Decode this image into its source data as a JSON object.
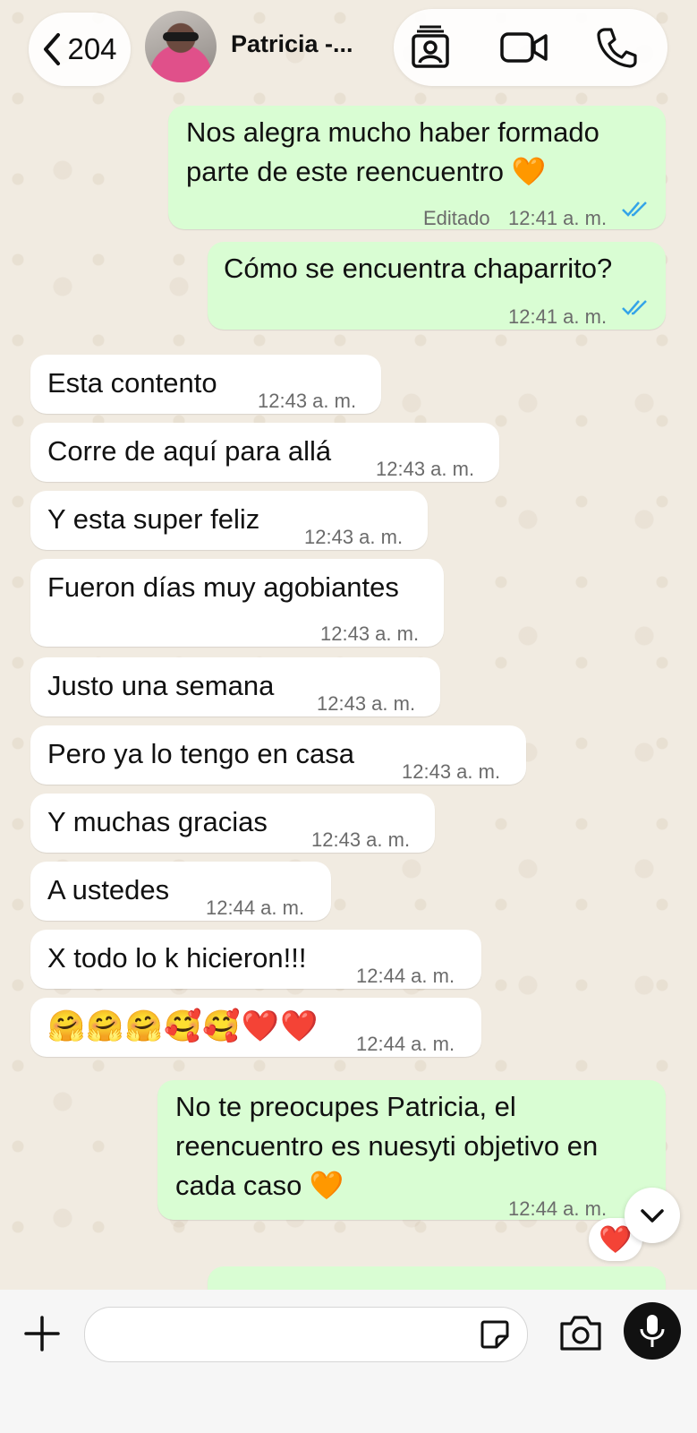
{
  "header": {
    "back_count": "204",
    "contact_name": "Patricia -..."
  },
  "messages": [
    {
      "dir": "out",
      "lines": [
        "Nos alegra mucho haber formado",
        "parte de este reencuentro 🧡"
      ],
      "edited": "Editado",
      "time": "12:41 a. m."
    },
    {
      "dir": "out",
      "lines": [
        "Cómo se encuentra chaparrito?"
      ],
      "time": "12:41 a. m."
    },
    {
      "dir": "in",
      "text": "Esta contento",
      "time": "12:43 a. m."
    },
    {
      "dir": "in",
      "text": "Corre de aquí para allá",
      "time": "12:43 a. m."
    },
    {
      "dir": "in",
      "text": "Y esta super feliz",
      "time": "12:43 a. m."
    },
    {
      "dir": "in",
      "text": "Fueron días muy agobiantes",
      "time": "12:43 a. m."
    },
    {
      "dir": "in",
      "text": "Justo una semana",
      "time": "12:43 a. m."
    },
    {
      "dir": "in",
      "text": "Pero ya lo tengo en casa",
      "time": "12:43 a. m."
    },
    {
      "dir": "in",
      "text": "Y muchas gracias",
      "time": "12:43 a. m."
    },
    {
      "dir": "in",
      "text": "A ustedes",
      "time": "12:44 a. m."
    },
    {
      "dir": "in",
      "text": "X todo lo k hicieron!!!",
      "time": "12:44 a. m."
    },
    {
      "dir": "in",
      "text": "🤗🤗🤗🥰🥰❤️❤️",
      "time": "12:44 a. m."
    },
    {
      "dir": "out",
      "lines": [
        "No te preocupes Patricia, el",
        "reencuentro es nuesyti objetivo en",
        "cada caso 🧡"
      ],
      "time": "12:44 a. m."
    }
  ],
  "reaction_emoji": "❤️",
  "colors": {
    "outgoing_bubble": "#d9fdd3",
    "incoming_bubble": "#ffffff",
    "read_ticks": "#34a4e8",
    "wallpaper": "#efe8dd"
  },
  "icons": [
    "chevron-left-icon",
    "contact-card-icon",
    "video-camera-icon",
    "phone-icon",
    "double-check-icon",
    "chevron-down-icon",
    "plus-icon",
    "sticker-icon",
    "camera-icon",
    "microphone-icon"
  ]
}
